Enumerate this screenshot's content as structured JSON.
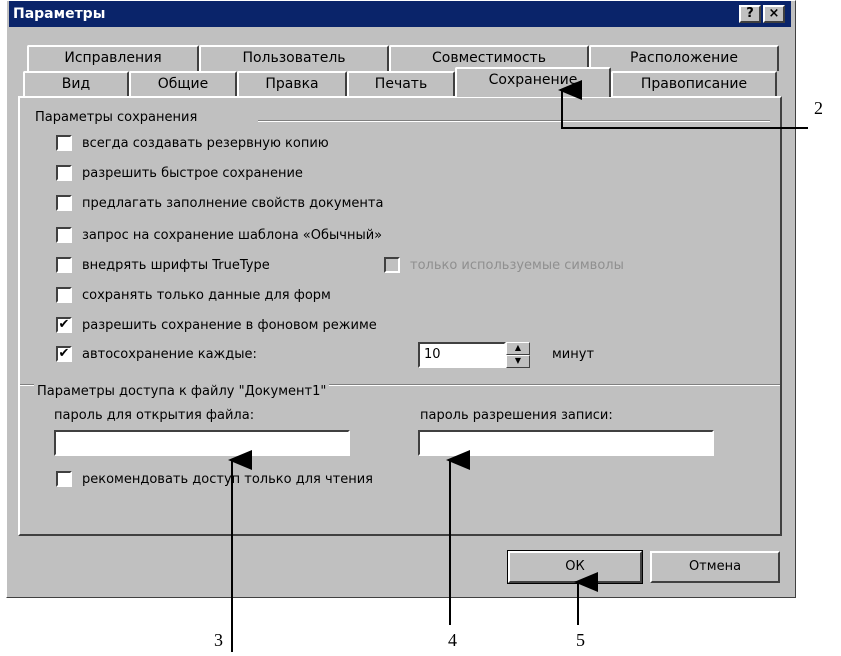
{
  "window": {
    "title": "Параметры",
    "help_label": "?",
    "close_label": "×"
  },
  "tabs_row1": [
    "Исправления",
    "Пользователь",
    "Совместимость",
    "Расположение"
  ],
  "tabs_row2": [
    "Вид",
    "Общие",
    "Правка",
    "Печать",
    "Сохранение",
    "Правописание"
  ],
  "active_tab": "Сохранение",
  "save_group": {
    "title": "Параметры сохранения",
    "options": [
      {
        "label": "всегда создавать резервную копию",
        "checked": false
      },
      {
        "label": "разрешить быстрое сохранение",
        "checked": false
      },
      {
        "label": "предлагать заполнение свойств документа",
        "checked": false
      },
      {
        "label": "запрос на сохранение шаблона «Обычный»",
        "checked": false
      },
      {
        "label": "внедрять шрифты TrueType",
        "checked": false
      },
      {
        "label": "сохранять только данные для форм",
        "checked": false
      },
      {
        "label": "разрешить сохранение в фоновом режиме",
        "checked": true
      },
      {
        "label": "автосохранение каждые:",
        "checked": true
      }
    ],
    "only_used_symbols": {
      "label": "только используемые символы",
      "checked": false,
      "enabled": false
    },
    "autosave_value": "10",
    "autosave_unit": "минут"
  },
  "access_group": {
    "title": "Параметры доступа к файлу \"Документ1\"",
    "open_password_label": "пароль для открытия файла:",
    "open_password_value": "",
    "write_password_label": "пароль разрешения записи:",
    "write_password_value": "",
    "readonly_label": "рекомендовать доступ только для чтения",
    "readonly_checked": false
  },
  "buttons": {
    "ok": "ОК",
    "cancel": "Отмена"
  },
  "callouts": [
    "2",
    "3",
    "4",
    "5"
  ]
}
